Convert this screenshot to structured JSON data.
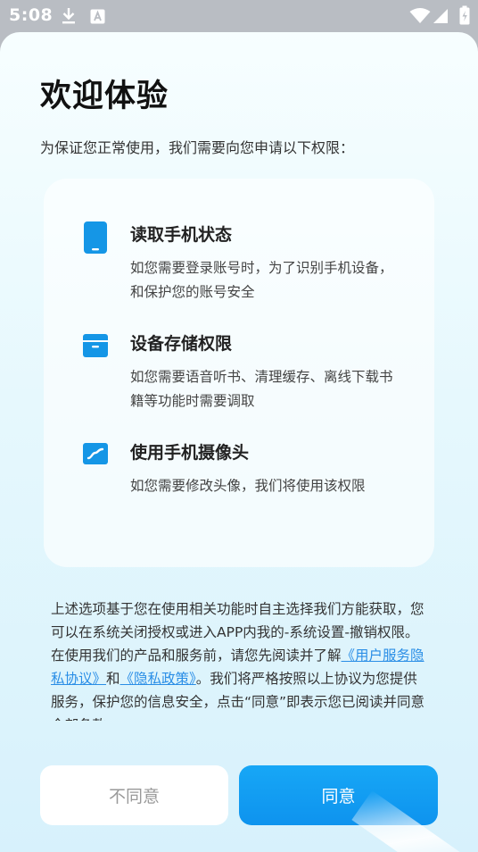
{
  "status_bar": {
    "time": "5:08",
    "icons": [
      "download-icon",
      "keyboard-a-icon",
      "wifi-icon",
      "signal-icon",
      "battery-icon"
    ]
  },
  "dialog": {
    "title": "欢迎体验",
    "subtitle": "为保证您正常使用，我们需要向您申请以下权限：",
    "permissions": [
      {
        "icon": "phone-icon",
        "title": "读取手机状态",
        "description": "如您需要登录账号时，为了识别手机设备，和保护您的账号安全"
      },
      {
        "icon": "storage-icon",
        "title": "设备存储权限",
        "description": "如您需要语音听书、清理缓存、离线下载书籍等功能时需要调取"
      },
      {
        "icon": "camera-icon",
        "title": "使用手机摄像头",
        "description": "如您需要修改头像，我们将使用该权限"
      }
    ],
    "notice": {
      "paragraph1": "上述选项基于您在使用相关功能时自主选择我们方能获取，您可以在系统关闭授权或进入APP内我的-系统设置-撤销权限。",
      "paragraph2_prefix": "在使用我们的产品和服务前，请您先阅读并了解",
      "user_agreement_link": "《用户服务隐私协议》",
      "connector": "和",
      "privacy_policy_link": "《隐私政策》",
      "paragraph2_suffix": "。我们将严格按照以上协议为您提供服务，保护您的信息安全，点击“同意”即表示您已阅读并同意全部条款。"
    },
    "buttons": {
      "disagree": "不同意",
      "agree": "同意"
    }
  },
  "colors": {
    "accent": "#0e93ee",
    "link": "#2a8ee6",
    "title": "#111111"
  }
}
